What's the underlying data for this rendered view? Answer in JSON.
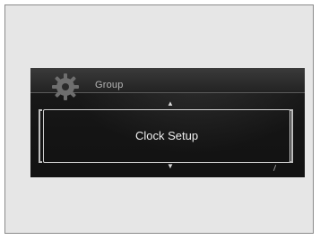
{
  "header": {
    "group_label": "Group",
    "icon": "gear-icon"
  },
  "menu": {
    "selected_item": "Clock Setup",
    "up_arrow": "▲",
    "down_arrow": "▼"
  },
  "colors": {
    "screen_background": "#141414",
    "frame_background": "#e6e6e6",
    "text": "#efefef"
  }
}
